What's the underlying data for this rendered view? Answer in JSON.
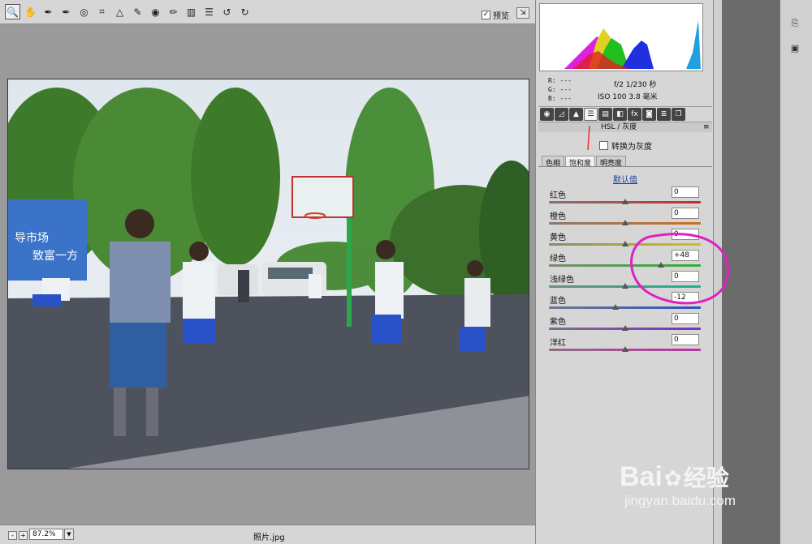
{
  "toolbar": {
    "tools": [
      {
        "name": "zoom-tool",
        "glyph": "🔍"
      },
      {
        "name": "hand-tool",
        "glyph": "✋"
      },
      {
        "name": "white-balance-tool",
        "glyph": "✒"
      },
      {
        "name": "color-sampler-tool",
        "glyph": "✒"
      },
      {
        "name": "targeted-adjustment-tool",
        "glyph": "◎"
      },
      {
        "name": "crop-tool",
        "glyph": "⌗"
      },
      {
        "name": "straighten-tool",
        "glyph": "△"
      },
      {
        "name": "spot-removal-tool",
        "glyph": "✎"
      },
      {
        "name": "red-eye-tool",
        "glyph": "◉"
      },
      {
        "name": "adjustment-brush-tool",
        "glyph": "✏"
      },
      {
        "name": "graduated-filter-tool",
        "glyph": "▥"
      },
      {
        "name": "preferences-tool",
        "glyph": "☰"
      },
      {
        "name": "rotate-left-tool",
        "glyph": "↺"
      },
      {
        "name": "rotate-right-tool",
        "glyph": "↻"
      }
    ],
    "preview_label": "预览",
    "preview_checked": "✓"
  },
  "status": {
    "zoom_minus": "-",
    "zoom_plus": "+",
    "zoom_value": "87.2%",
    "zoom_arrow": "▼",
    "filename": "照片.jpg"
  },
  "info": {
    "r": "R:  ---",
    "g": "G:  ---",
    "b": "B:  ---",
    "aperture_shutter": "f/2   1/230 秒",
    "iso_focal": "ISO 100   3.8 毫米"
  },
  "panel": {
    "section_title": "HSL / 灰度",
    "section_menu": "≡",
    "convert_label": "转换为灰度",
    "subtabs": [
      "色相",
      "饱和度",
      "明亮度"
    ],
    "default_link": "默认值",
    "sliders": [
      {
        "label": "红色",
        "value": "0",
        "level": 0,
        "color": "linear-gradient(90deg,#8a7070,#c03030)"
      },
      {
        "label": "橙色",
        "value": "0",
        "level": 0,
        "color": "linear-gradient(90deg,#8a7a70,#d07020)"
      },
      {
        "label": "黄色",
        "value": "0",
        "level": 0,
        "color": "linear-gradient(90deg,#8a8a70,#d0c020)"
      },
      {
        "label": "绿色",
        "value": "+48",
        "level": 48,
        "color": "linear-gradient(90deg,#7a8a70,#30b030)"
      },
      {
        "label": "浅绿色",
        "value": "0",
        "level": 0,
        "color": "linear-gradient(90deg,#708a84,#20b090)"
      },
      {
        "label": "蓝色",
        "value": "-12",
        "level": -12,
        "color": "linear-gradient(90deg,#707a8a,#3050c0)"
      },
      {
        "label": "紫色",
        "value": "0",
        "level": 0,
        "color": "linear-gradient(90deg,#7a708a,#8030c0)"
      },
      {
        "label": "洋红",
        "value": "0",
        "level": 0,
        "color": "linear-gradient(90deg,#8a7084,#c030a0)"
      }
    ]
  },
  "watermark": {
    "brand": "Bai",
    "brand_suffix": "经验",
    "url": "jingyan.baidu.com"
  },
  "accent_colors": {
    "annotation": "#e020c0",
    "arrow": "#e03030"
  }
}
